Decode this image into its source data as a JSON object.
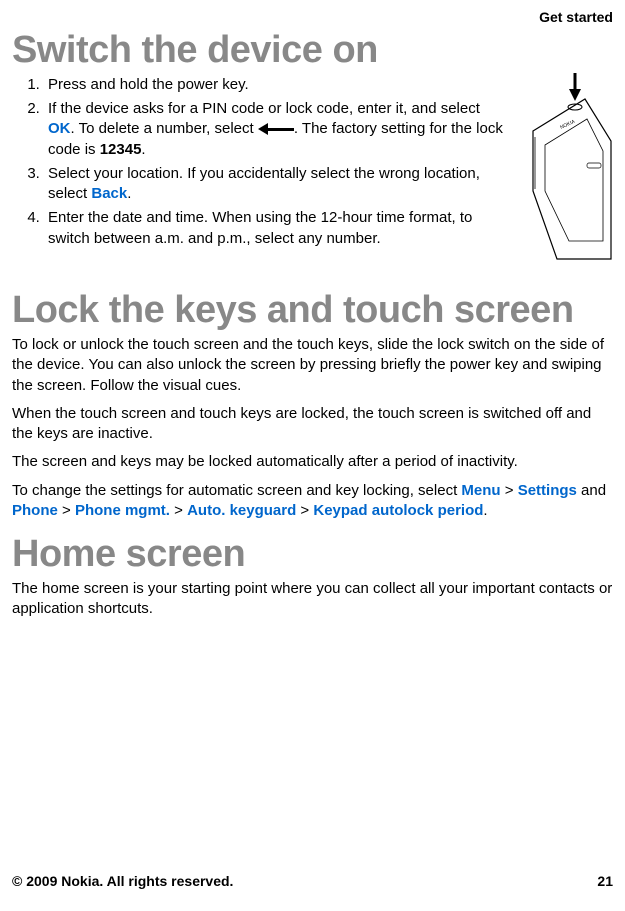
{
  "header": {
    "section": "Get started"
  },
  "switch": {
    "title": "Switch the device on",
    "steps": {
      "1": "Press and hold the power key.",
      "2a": "If the device asks for a PIN code or lock code, enter it, and select ",
      "2_ok": "OK",
      "2b": ". To delete a number, select ",
      "2c": ". The factory setting for the lock code is ",
      "2_code": "12345",
      "2d": ".",
      "3a": "Select your location. If you accidentally select the wrong location, select ",
      "3_back": "Back",
      "3b": ".",
      "4": "Enter the date and time. When using the 12-hour time format, to switch between a.m. and p.m., select any number."
    }
  },
  "lock": {
    "title": "Lock the keys and touch screen",
    "p1": "To lock or unlock the touch screen and the touch keys, slide the lock switch on the side of the device. You can also unlock the screen by pressing briefly the power key and swiping the screen. Follow the visual cues.",
    "p2": "When the touch screen and touch keys are locked, the touch screen is switched off and the keys are inactive.",
    "p3": "The screen and keys may be locked automatically after a period of inactivity.",
    "p4a": "To change the settings for automatic screen and key locking, select ",
    "menu": "Menu",
    "sep": " > ",
    "settings": "Settings",
    "p4b": " and ",
    "phone": "Phone",
    "phone_mgmt": "Phone mgmt.",
    "auto": "Auto. keyguard",
    "keypad": "Keypad autolock period",
    "p4c": "."
  },
  "home": {
    "title": "Home screen",
    "p1": "The home screen is your starting point where you can collect all your important contacts or application shortcuts."
  },
  "footer": {
    "copyright": "© 2009 Nokia. All rights reserved.",
    "page": "21"
  }
}
